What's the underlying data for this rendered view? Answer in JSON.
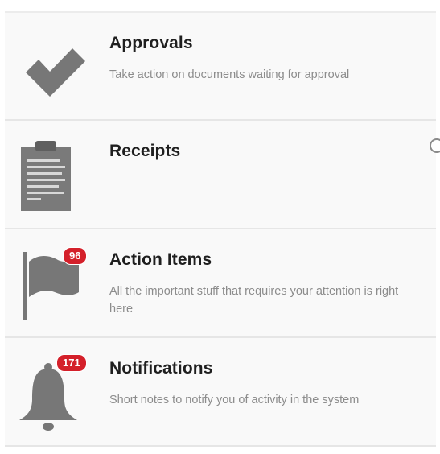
{
  "menu": {
    "items": [
      {
        "title": "Approvals",
        "description": "Take action on documents waiting for approval",
        "icon": "checkmark-icon"
      },
      {
        "title": "Receipts",
        "description": "",
        "icon": "clipboard-icon"
      },
      {
        "title": "Action Items",
        "description": "All the important stuff that requires your attention is right here",
        "icon": "flag-icon",
        "badge": "96"
      },
      {
        "title": "Notifications",
        "description": "Short notes to notify you of activity in the system",
        "icon": "bell-icon",
        "badge": "171"
      }
    ]
  },
  "colors": {
    "icon": "#777777",
    "badge": "#d4202a",
    "title": "#1f1f1f",
    "description": "#8c8c8c",
    "row_background": "#f9f9f9"
  }
}
